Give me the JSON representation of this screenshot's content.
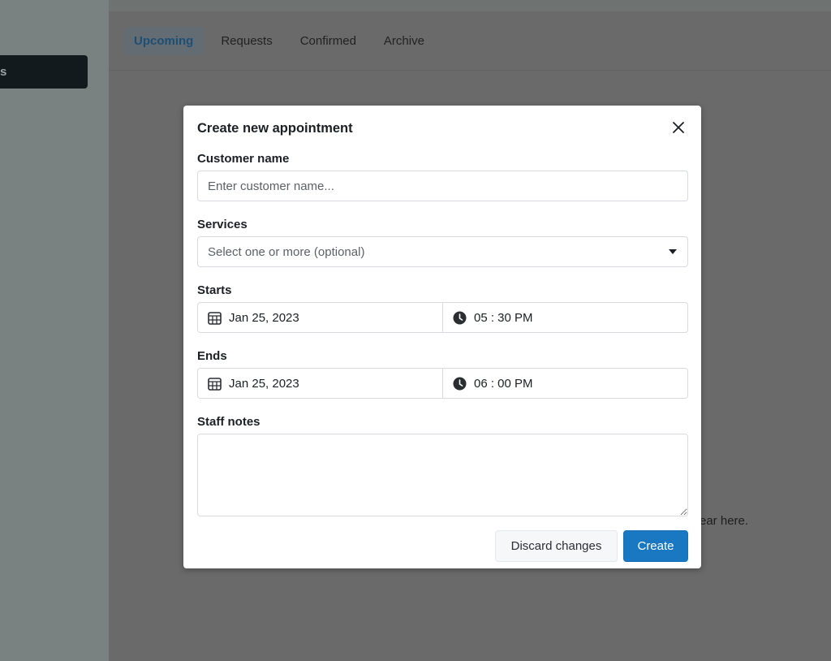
{
  "sidebar": {
    "active_item_fragment": "s"
  },
  "tabs": [
    {
      "label": "Upcoming",
      "active": true
    },
    {
      "label": "Requests"
    },
    {
      "label": "Confirmed"
    },
    {
      "label": "Archive"
    }
  ],
  "background_text": "ear here.",
  "modal": {
    "title": "Create new appointment",
    "customer_label": "Customer name",
    "customer_placeholder": "Enter customer name...",
    "customer_value": "",
    "services_label": "Services",
    "services_placeholder": "Select one or more (optional)",
    "starts_label": "Starts",
    "starts_date": "Jan 25, 2023",
    "starts_time": "05 : 30 PM",
    "ends_label": "Ends",
    "ends_date": "Jan 25, 2023",
    "ends_time": "06 : 00 PM",
    "notes_label": "Staff notes",
    "notes_value": "",
    "discard_label": "Discard changes",
    "create_label": "Create"
  },
  "colors": {
    "primary": "#1a78c2",
    "overlay_tab_active": "#1d4f75"
  }
}
